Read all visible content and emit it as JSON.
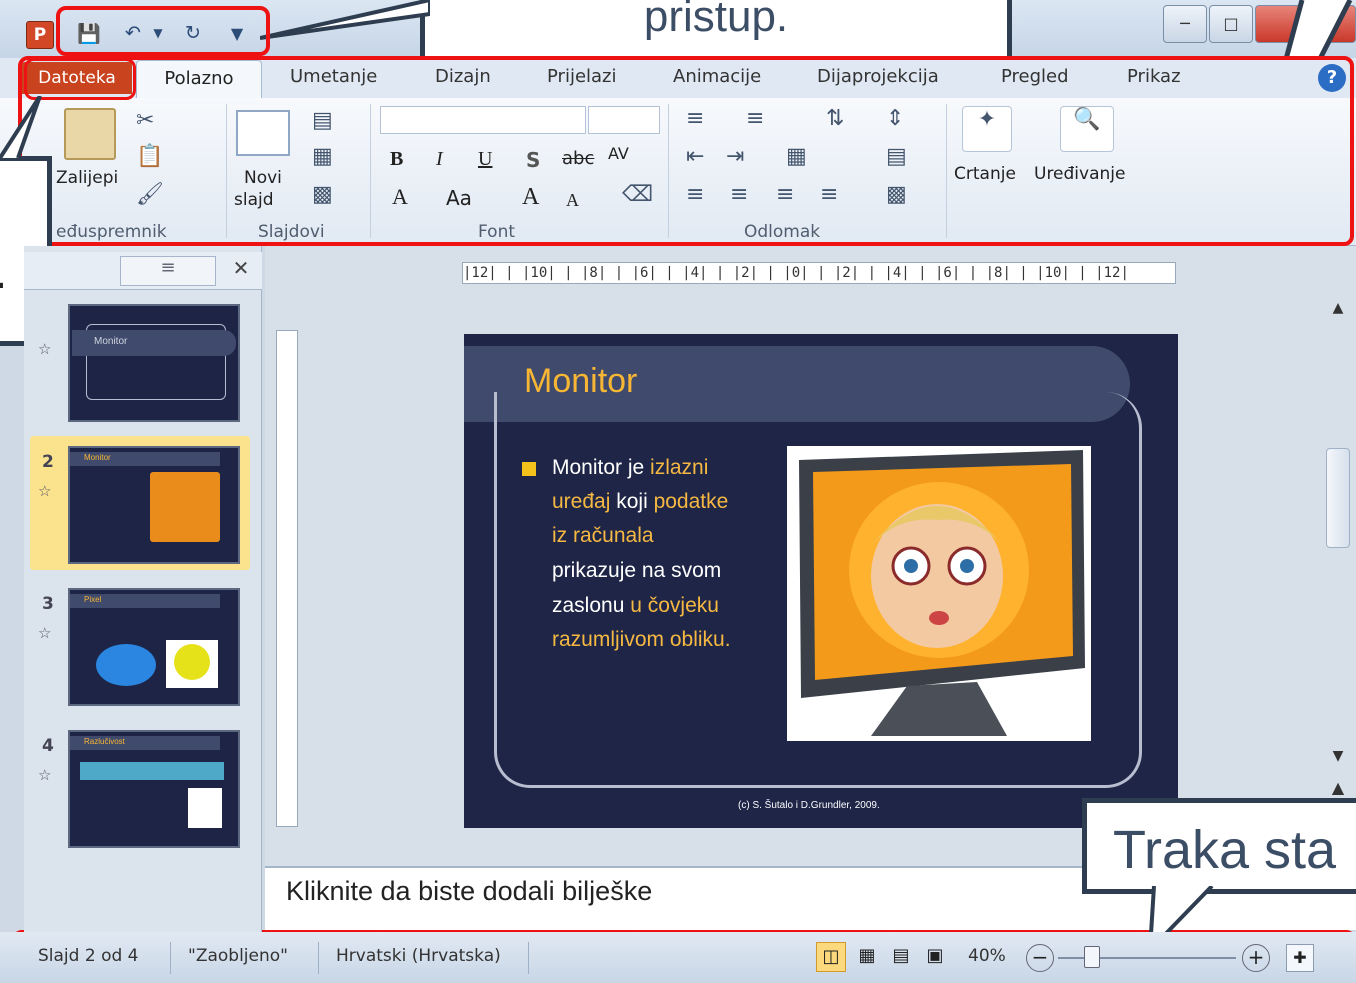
{
  "callouts": {
    "quick_access": "pristup.",
    "status_bar": "Traka sta",
    "left_edge": "."
  },
  "tabs": [
    "Datoteka",
    "Polazno",
    "Umetanje",
    "Dizajn",
    "Prijelazi",
    "Animacije",
    "Dijaprojekcija",
    "Pregled",
    "Prikaz"
  ],
  "ribbon": {
    "clipboard": {
      "paste_label": "Zalijepi",
      "group_label": "eđuspremnik"
    },
    "slides": {
      "new_slide_line1": "Novi",
      "new_slide_line2": "slajd",
      "group_label": "Slajdovi"
    },
    "font": {
      "group_label": "Font",
      "bold": "B",
      "italic": "I",
      "underline": "U",
      "shadow": "S",
      "strike": "abc",
      "spacing": "AV",
      "color": "A",
      "case": "Aa",
      "grow": "A",
      "shrink": "A"
    },
    "paragraph": {
      "group_label": "Odlomak"
    },
    "drawing": {
      "label": "Crtanje"
    },
    "editing": {
      "label": "Uređivanje"
    }
  },
  "ruler": {
    "horizontal": "|12| | |10| | |8| | |6| | |4| | |2| | |0| | |2| | |4| | |6| | |8| | |10| | |12|"
  },
  "thumbnails": [
    {
      "number": "",
      "title": "Monitor"
    },
    {
      "number": "2",
      "title": "Monitor"
    },
    {
      "number": "3",
      "title": "Pixel"
    },
    {
      "number": "4",
      "title": "Razlučivost"
    }
  ],
  "slide": {
    "title": "Monitor",
    "text_parts": [
      "Monitor",
      " je ",
      "izlazni",
      "uređaj",
      " koji ",
      "podatke",
      "iz računala",
      "prikazuje na svom",
      "zaslonu",
      " u čovjeku",
      "razumljivom obliku."
    ],
    "footer": "(c) S. Šutalo  i D.Grundler,  2009."
  },
  "notes": {
    "placeholder": "Kliknite da biste dodali bilješke"
  },
  "statusbar": {
    "slide": "Slajd 2 od 4",
    "theme": "\"Zaobljeno\"",
    "language": "Hrvatski (Hrvatska)",
    "zoom": "40%"
  },
  "colors": {
    "highlight": "#ee1212",
    "slide_bg": "#1e2547",
    "title": "#f7b634",
    "file_tab": "#c8431e"
  }
}
